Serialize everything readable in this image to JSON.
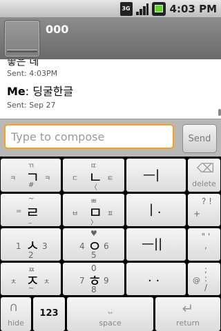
{
  "status": {
    "network": "3G",
    "time": "4:03 PM",
    "icons": [
      "3g-icon",
      "signal-icon",
      "battery-icon"
    ]
  },
  "header": {
    "title": "000"
  },
  "messages": [
    {
      "text_cut": "좋은 데",
      "sent": "Sent: 4:03PM"
    },
    {
      "sender": "Me",
      "text": "딩굴한글",
      "sent": "Sent: Sep 27"
    }
  ],
  "compose": {
    "placeholder": "Type to compose",
    "send_label": "Send"
  },
  "keyboard": {
    "rows": [
      [
        {
          "main": "ㄱ",
          "top": "ㄲ",
          "left": "ㅋ",
          "right": "ㅋ",
          "bottom": "#"
        },
        {
          "main": "ㄴ",
          "top": "ㄸ",
          "left": "ㄷ",
          "right": "ㅌ",
          "bottom": "〈"
        },
        {
          "main": "—|"
        },
        {
          "main": "⌫",
          "label": "delete"
        }
      ],
      [
        {
          "main": "ㄹ",
          "top": "~",
          "left": "=",
          "bottom": "_"
        },
        {
          "main": "ㅁ",
          "top": "ㅃ",
          "left": "ㅂ",
          "right": "ㅍ",
          "bottom": "〉"
        },
        {
          "main": "| ."
        },
        {
          "main": "? !",
          "label": "+"
        }
      ],
      [
        {
          "main": "ㅅ",
          "top": "",
          "left": "1",
          "right": "3",
          "bottom": "2"
        },
        {
          "main": "ㅇ",
          "top": "♥",
          "left": "4",
          "right": "6",
          "bottom": "5"
        },
        {
          "main": "—||"
        },
        {
          "main": "\" ' ,",
          "label": ""
        }
      ],
      [
        {
          "main": "ㅈ",
          "top": "ㅉ",
          "left": "ㅊ",
          "right": "ㅊ",
          "bottom": "~"
        },
        {
          "main": "ㅎ",
          "top": "0",
          "left": "7",
          "right": "9",
          "bottom": "8"
        },
        {
          "main": ". ."
        },
        {
          "main": "; : /",
          "label": "@"
        }
      ]
    ],
    "bottom": {
      "hide": "hide",
      "num": "123",
      "space": "space",
      "return": "return"
    }
  }
}
